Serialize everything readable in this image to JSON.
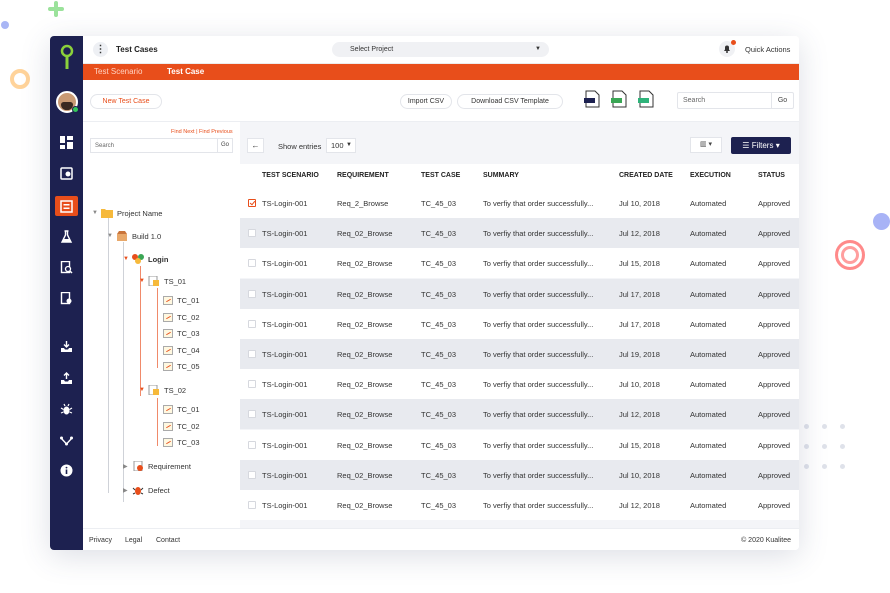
{
  "colors": {
    "accent": "#e84e1b",
    "navy": "#1d2150"
  },
  "header": {
    "title": "Test Cases",
    "project_select": "Select Project",
    "quick_actions": "Quick Actions"
  },
  "tabs": [
    {
      "label": "Test Scenario",
      "active": false
    },
    {
      "label": "Test Case",
      "active": true
    }
  ],
  "toolbar": {
    "new_test_case": "New Test Case",
    "import_csv": "Import CSV",
    "download_csv_template": "Download CSV Template",
    "search_placeholder": "Search",
    "go": "Go"
  },
  "tree": {
    "find_links": "Find Next | Find Previous",
    "search_placeholder": "Search",
    "go": "Go",
    "project": "Project Name",
    "build": "Build 1.0",
    "login": "Login",
    "ts_01": "TS_01",
    "ts_01_cases": [
      "TC_01",
      "TC_02",
      "TC_03",
      "TC_04",
      "TC_05"
    ],
    "ts_02": "TS_02",
    "ts_02_cases": [
      "TC_01",
      "TC_02",
      "TC_03"
    ],
    "requirement": "Requirement",
    "defect": "Defect"
  },
  "grid": {
    "show_entries": "Show entries",
    "entries_value": "100",
    "filters": "Filters",
    "columns": [
      "TEST SCENARIO",
      "REQUIREMENT",
      "TEST CASE",
      "SUMMARY",
      "CREATED DATE",
      "EXECUTION",
      "STATUS"
    ],
    "rows": [
      {
        "checked": true,
        "scenario": "TS-Login-001",
        "requirement": "Req_2_Browse",
        "test_case": "TC_45_03",
        "summary": "To verfiy that order successfully...",
        "date": "Jul 10, 2018",
        "execution": "Automated",
        "status": "Approved"
      },
      {
        "checked": false,
        "scenario": "TS-Login-001",
        "requirement": "Req_02_Browse",
        "test_case": "TC_45_03",
        "summary": "To verfiy that order successfully...",
        "date": "Jul 12, 2018",
        "execution": "Automated",
        "status": "Approved"
      },
      {
        "checked": false,
        "scenario": "TS-Login-001",
        "requirement": "Req_02_Browse",
        "test_case": "TC_45_03",
        "summary": "To verfiy that order successfully...",
        "date": "Jul 15, 2018",
        "execution": "Automated",
        "status": "Approved"
      },
      {
        "checked": false,
        "scenario": "TS-Login-001",
        "requirement": "Req_02_Browse",
        "test_case": "TC_45_03",
        "summary": "To verfiy that order successfully...",
        "date": "Jul 17, 2018",
        "execution": "Automated",
        "status": "Approved"
      },
      {
        "checked": false,
        "scenario": "TS-Login-001",
        "requirement": "Req_02_Browse",
        "test_case": "TC_45_03",
        "summary": "To verfiy that order successfully...",
        "date": "Jul 17, 2018",
        "execution": "Automated",
        "status": "Approved"
      },
      {
        "checked": false,
        "scenario": "TS-Login-001",
        "requirement": "Req_02_Browse",
        "test_case": "TC_45_03",
        "summary": "To verfiy that order successfully...",
        "date": "Jul 19, 2018",
        "execution": "Automated",
        "status": "Approved"
      },
      {
        "checked": false,
        "scenario": "TS-Login-001",
        "requirement": "Req_02_Browse",
        "test_case": "TC_45_03",
        "summary": "To verfiy that order successfully...",
        "date": "Jul 10, 2018",
        "execution": "Automated",
        "status": "Approved"
      },
      {
        "checked": false,
        "scenario": "TS-Login-001",
        "requirement": "Req_02_Browse",
        "test_case": "TC_45_03",
        "summary": "To verfiy that order successfully...",
        "date": "Jul 12, 2018",
        "execution": "Automated",
        "status": "Approved"
      },
      {
        "checked": false,
        "scenario": "TS-Login-001",
        "requirement": "Req_02_Browse",
        "test_case": "TC_45_03",
        "summary": "To verfiy that order successfully...",
        "date": "Jul 15, 2018",
        "execution": "Automated",
        "status": "Approved"
      },
      {
        "checked": false,
        "scenario": "TS-Login-001",
        "requirement": "Req_02_Browse",
        "test_case": "TC_45_03",
        "summary": "To verfiy that order successfully...",
        "date": "Jul 10, 2018",
        "execution": "Automated",
        "status": "Approved"
      },
      {
        "checked": false,
        "scenario": "TS-Login-001",
        "requirement": "Req_02_Browse",
        "test_case": "TC_45_03",
        "summary": "To verfiy that order successfully...",
        "date": "Jul 12, 2018",
        "execution": "Automated",
        "status": "Approved"
      }
    ]
  },
  "footer": {
    "privacy": "Privacy",
    "legal": "Legal",
    "contact": "Contact",
    "copyright": "© 2020 Kualitee"
  }
}
